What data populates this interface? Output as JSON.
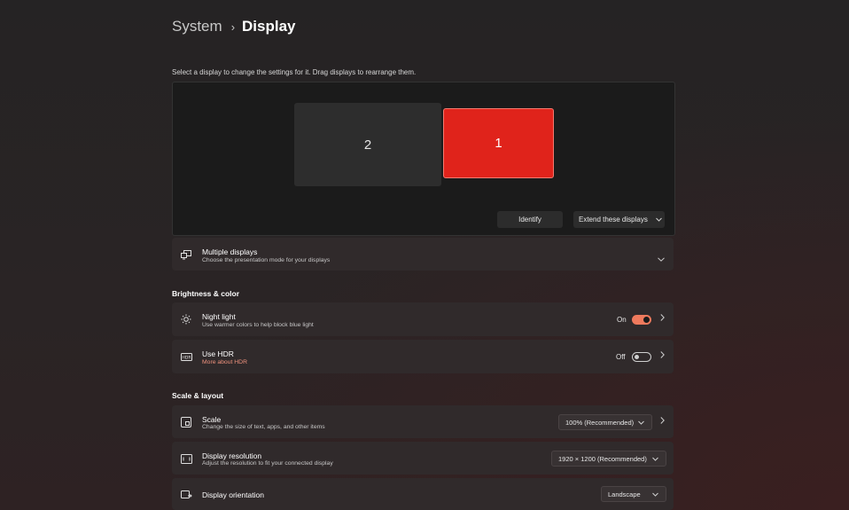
{
  "breadcrumb": {
    "parent": "System",
    "separator": "›",
    "current": "Display"
  },
  "arrange": {
    "instruction": "Select a display to change the settings for it. Drag displays to rearrange them.",
    "monitors": [
      {
        "label": "2",
        "selected": false
      },
      {
        "label": "1",
        "selected": true
      }
    ],
    "identify_label": "Identify",
    "mode_value": "Extend these displays"
  },
  "multiple_displays": {
    "icon": "multiple-displays-icon",
    "title": "Multiple displays",
    "subtitle": "Choose the presentation mode for your displays"
  },
  "brightness_section": {
    "heading": "Brightness & color",
    "night_light": {
      "icon": "brightness-icon",
      "title": "Night light",
      "subtitle": "Use warmer colors to help block blue light",
      "state_label": "On",
      "on": true
    },
    "hdr": {
      "icon": "hdr-icon",
      "title": "Use HDR",
      "subtitle": "More about HDR",
      "state_label": "Off",
      "on": false
    }
  },
  "scale_section": {
    "heading": "Scale & layout",
    "scale": {
      "icon": "scale-icon",
      "title": "Scale",
      "subtitle": "Change the size of text, apps, and other items",
      "value": "100% (Recommended)"
    },
    "resolution": {
      "icon": "resolution-icon",
      "title": "Display resolution",
      "subtitle": "Adjust the resolution to fit your connected display",
      "value": "1920 × 1200 (Recommended)"
    },
    "orientation": {
      "icon": "orientation-icon",
      "title": "Display orientation",
      "value": "Landscape"
    }
  },
  "colors": {
    "accent": "#ef7a5d",
    "selected_monitor": "#e0231b",
    "link": "#f0927e"
  }
}
